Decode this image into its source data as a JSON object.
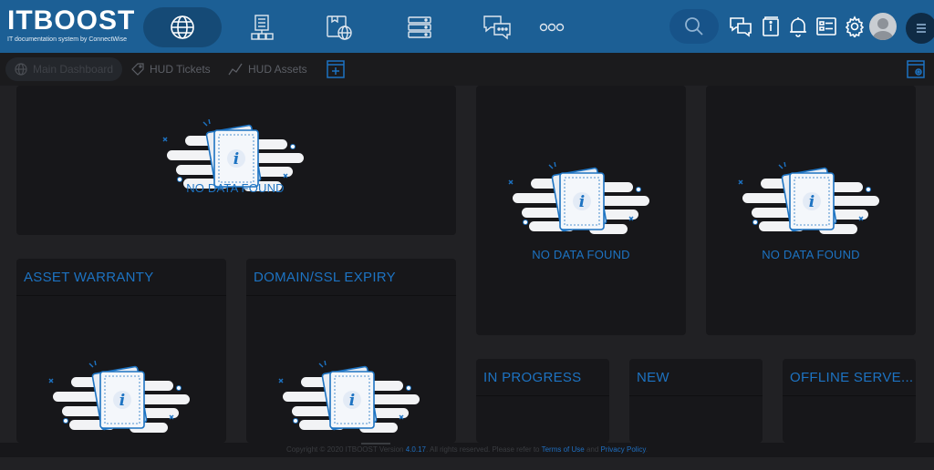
{
  "header": {
    "logo_text": "ITBOOST",
    "logo_subtitle": "IT documentation system by ConnectWise",
    "nav_icons": [
      "globe-icon",
      "organizations-icon",
      "documents-globe-icon",
      "server-icon",
      "chat-icon",
      "more-icon"
    ],
    "right_icons": [
      "search-icon",
      "chat-bubbles-icon",
      "book-icon",
      "bell-icon",
      "dashboard-icon",
      "gear-icon",
      "avatar",
      "menu-icon"
    ]
  },
  "tabs": [
    {
      "label": "Main Dashboard",
      "icon": "globe-icon",
      "active": true
    },
    {
      "label": "HUD Tickets",
      "icon": "tag-icon",
      "active": false
    },
    {
      "label": "HUD Assets",
      "icon": "trend-icon",
      "active": false
    }
  ],
  "widgets": {
    "top_left": {
      "title": "",
      "message": "NO DATA FOUND"
    },
    "top_mid": {
      "title": "",
      "message": "NO DATA FOUND"
    },
    "top_right": {
      "title": "",
      "message": "NO DATA FOUND"
    },
    "asset_warranty": {
      "title": "ASSET WARRANTY",
      "message": ""
    },
    "domain_ssl": {
      "title": "DOMAIN/SSL EXPIRY",
      "message": ""
    },
    "in_progress": {
      "title": "IN PROGRESS"
    },
    "new": {
      "title": "NEW"
    },
    "offline_servers": {
      "title": "OFFLINE SERVE..."
    }
  },
  "footer": {
    "copyright": "Copyright © 2020 ITBOOST Version",
    "version": "4.0.17",
    "rights": ". All rights reserved. Please refer to",
    "terms": "Terms of Use",
    "and": "and",
    "privacy": "Privacy Policy"
  },
  "colors": {
    "brand": "#1c5f95",
    "accent": "#1d73c2",
    "background": "#212124"
  }
}
